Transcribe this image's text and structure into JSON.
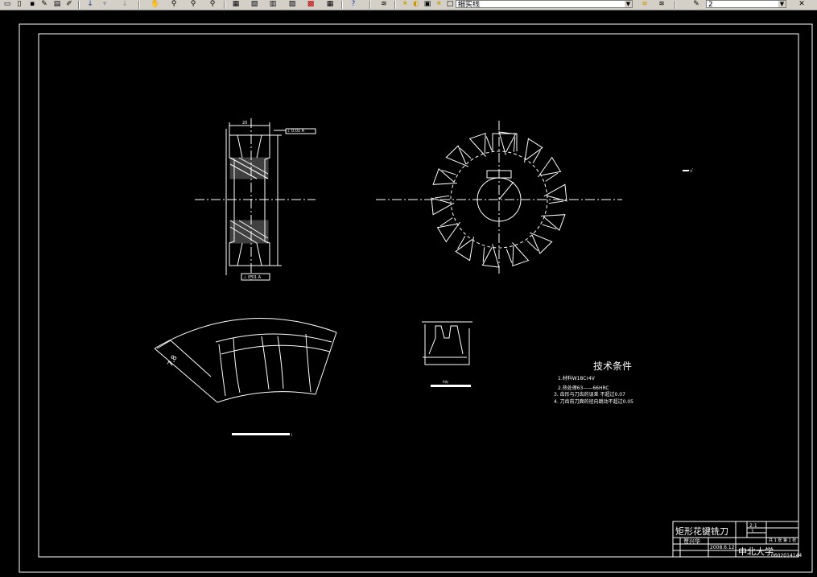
{
  "toolbar": {
    "layer_name": "细实线",
    "linetype_value": "2",
    "icons": [
      "new-icon",
      "open-icon",
      "save-icon",
      "print-icon",
      "brush-icon",
      "undo-icon",
      "redo-icon",
      "pan-icon",
      "zoom-realtime-icon",
      "zoom-window-icon",
      "zoom-previous-icon",
      "properties-icon",
      "design-center-icon",
      "tool-palette-icon",
      "sheet-set-icon",
      "markup-icon",
      "calculator-icon",
      "help-icon",
      "layer-manager-icon",
      "layer-state-icons",
      "layer-previous-icon",
      "layer-iso-icon",
      "match-properties-icon",
      "close-icon"
    ]
  },
  "drawing": {
    "title_block": {
      "part_name": "矩形花键铣刀",
      "scale": "2:1",
      "quantity": "1",
      "sheet": "共 1 张 第 1 张",
      "designer": "贾兴华",
      "date": "2008.6.12",
      "school": "中北大学",
      "student_no": "0602014144"
    },
    "tech_requirements": {
      "title": "技术条件",
      "items": [
        "1.材料W18Cr4V",
        "2.热处理63——66HRC",
        "3. 齿形与刀齿的误差   不超过0.07",
        "4. 刀齿前刀面的径向跳动不超过0.05"
      ]
    },
    "dimensions": {
      "angle_label": "7.8",
      "view_label_a": "A向",
      "detail_label": "I",
      "roughness_small": "√",
      "tol_frame_top": "⊥ 0.01 A",
      "tol_frame_bottom": "⊥ 0.01 A",
      "width_label": "20",
      "diameter_label": "Φ80"
    }
  }
}
